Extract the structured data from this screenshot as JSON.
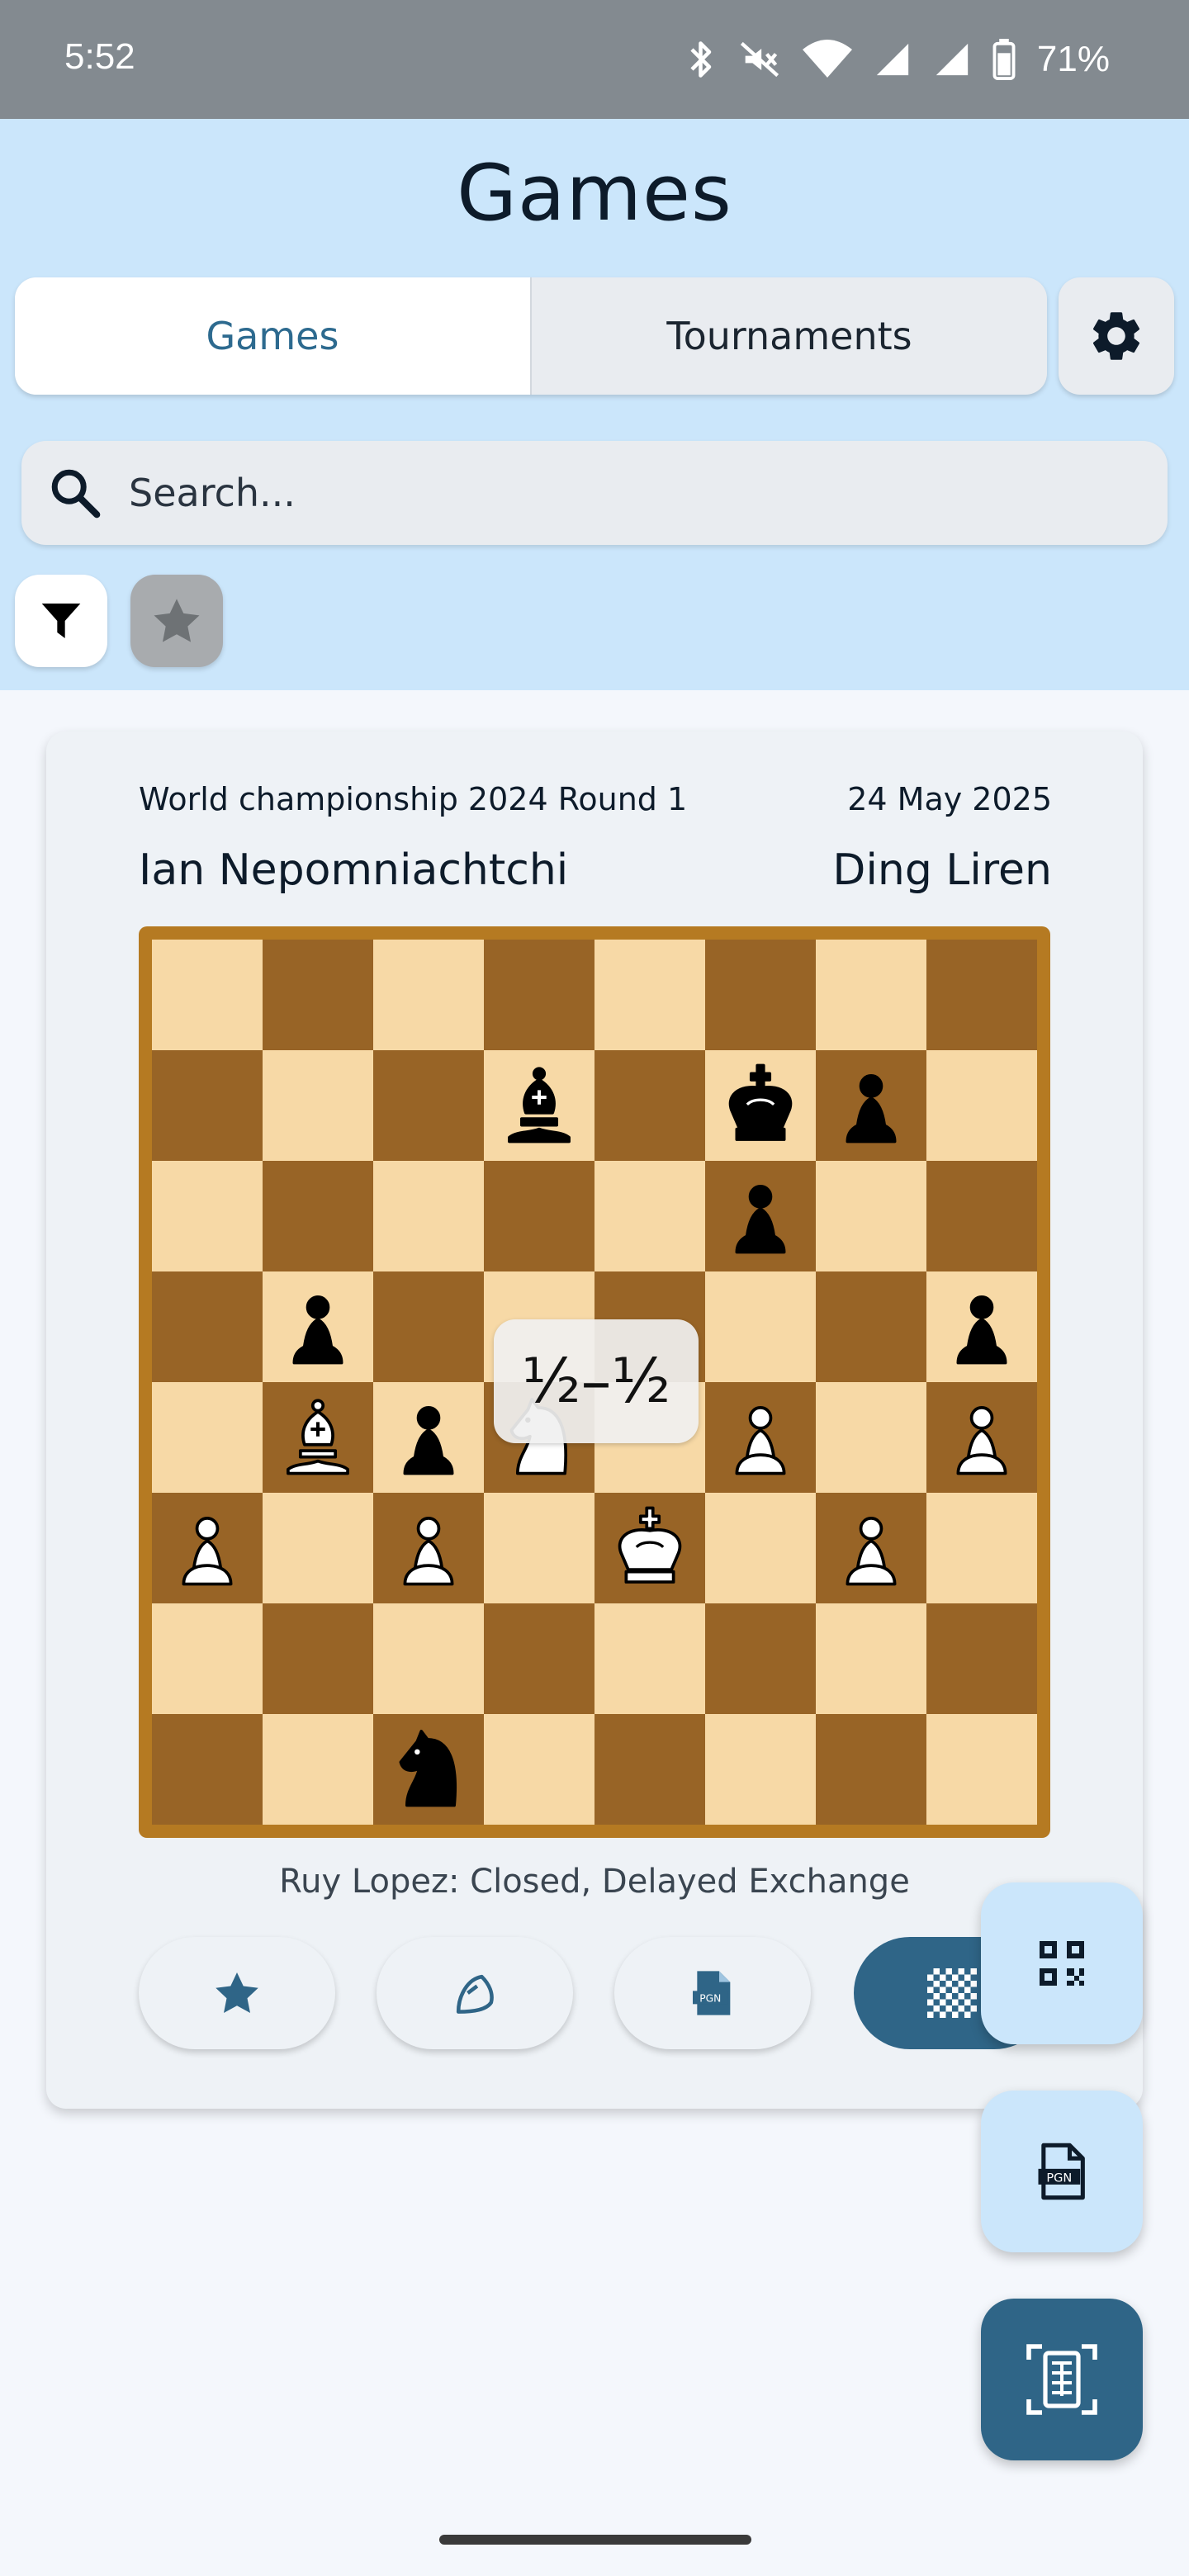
{
  "status_bar": {
    "time": "5:52",
    "battery": "71%",
    "icons": [
      "bluetooth-icon",
      "mute-icon",
      "wifi-icon",
      "signal-icon",
      "signal-icon",
      "battery-icon"
    ]
  },
  "header": {
    "title": "Games",
    "tabs": [
      {
        "label": "Games",
        "active": true
      },
      {
        "label": "Tournaments",
        "active": false
      }
    ],
    "settings_icon": "gear-icon",
    "search": {
      "placeholder": "Search..."
    },
    "filters": [
      {
        "icon": "filter-icon",
        "active": true
      },
      {
        "icon": "star-icon",
        "active": false
      }
    ]
  },
  "game": {
    "event": "World championship 2024  Round 1",
    "date": "24 May 2025",
    "white": "Ian Nepomniachtchi",
    "black": "Ding Liren",
    "result": "½–½",
    "opening": "Ruy Lopez: Closed, Delayed Exchange",
    "position": [
      [
        "",
        "",
        "",
        "",
        "",
        "",
        "",
        ""
      ],
      [
        "",
        "",
        "",
        "b",
        "",
        "k",
        "p",
        ""
      ],
      [
        "",
        "",
        "",
        "",
        "",
        "p",
        "",
        ""
      ],
      [
        "",
        "p",
        "",
        "",
        "",
        "",
        "",
        "p"
      ],
      [
        "",
        "B",
        "p",
        "N",
        "",
        "P",
        "",
        "P"
      ],
      [
        "P",
        "",
        "P",
        "",
        "K",
        "",
        "P",
        ""
      ],
      [
        "",
        "",
        "",
        "",
        "",
        "",
        "",
        ""
      ],
      [
        "",
        "",
        "n",
        "",
        "",
        "",
        "",
        ""
      ]
    ],
    "actions": [
      {
        "icon": "star-icon"
      },
      {
        "icon": "chess-analysis-icon"
      },
      {
        "icon": "pgn-file-icon"
      },
      {
        "icon": "chessboard-icon"
      }
    ]
  },
  "fabs": [
    {
      "icon": "qr-code-icon"
    },
    {
      "icon": "pgn-file-icon"
    },
    {
      "icon": "scan-scoresheet-icon"
    }
  ],
  "colors": {
    "header_bg": "#cbe6fb",
    "accent": "#2f6587",
    "light_square": "#f7d9a6",
    "dark_square": "#986426",
    "board_border": "#b57a22"
  }
}
